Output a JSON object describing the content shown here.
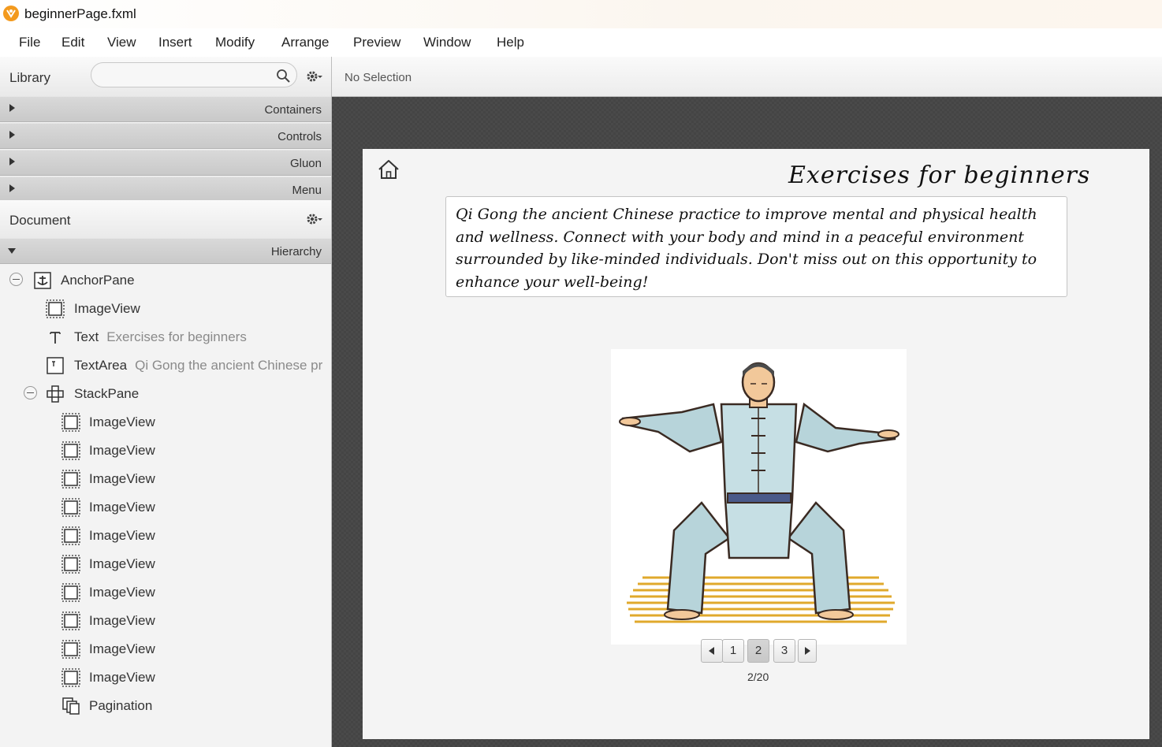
{
  "window": {
    "title": "beginnerPage.fxml"
  },
  "menu": [
    "File",
    "Edit",
    "View",
    "Insert",
    "Modify",
    "Arrange",
    "Preview",
    "Window",
    "Help"
  ],
  "library": {
    "title": "Library",
    "search_value": "",
    "sections": [
      "Containers",
      "Controls",
      "Gluon",
      "Menu"
    ]
  },
  "document": {
    "title": "Document",
    "section": "Hierarchy",
    "tree": [
      {
        "name": "AnchorPane",
        "detail": "",
        "icon": "anchor-icon"
      },
      {
        "name": "ImageView",
        "detail": "",
        "icon": "imageview-icon"
      },
      {
        "name": "Text",
        "detail": "Exercises for beginners",
        "icon": "text-icon"
      },
      {
        "name": "TextArea",
        "detail": "Qi Gong the ancient Chinese pr",
        "icon": "textarea-icon"
      },
      {
        "name": "StackPane",
        "detail": "",
        "icon": "stackpane-icon"
      },
      {
        "name": "ImageView",
        "detail": "",
        "icon": "imageview-icon"
      },
      {
        "name": "ImageView",
        "detail": "",
        "icon": "imageview-icon"
      },
      {
        "name": "ImageView",
        "detail": "",
        "icon": "imageview-icon"
      },
      {
        "name": "ImageView",
        "detail": "",
        "icon": "imageview-icon"
      },
      {
        "name": "ImageView",
        "detail": "",
        "icon": "imageview-icon"
      },
      {
        "name": "ImageView",
        "detail": "",
        "icon": "imageview-icon"
      },
      {
        "name": "ImageView",
        "detail": "",
        "icon": "imageview-icon"
      },
      {
        "name": "ImageView",
        "detail": "",
        "icon": "imageview-icon"
      },
      {
        "name": "ImageView",
        "detail": "",
        "icon": "imageview-icon"
      },
      {
        "name": "ImageView",
        "detail": "",
        "icon": "imageview-icon"
      },
      {
        "name": "Pagination",
        "detail": "",
        "icon": "pagination-icon"
      }
    ]
  },
  "selection": {
    "text": "No Selection"
  },
  "preview": {
    "title": "Exercises for beginners",
    "description": "Qi Gong the ancient Chinese practice to improve mental and physical health and wellness. Connect with your body and mind in a peaceful environment surrounded by like-minded individuals. Don't miss out on this opportunity to enhance your well-being!",
    "pagination": {
      "pages": [
        "1",
        "2",
        "3"
      ],
      "selected": "2",
      "count": "2/20"
    }
  }
}
